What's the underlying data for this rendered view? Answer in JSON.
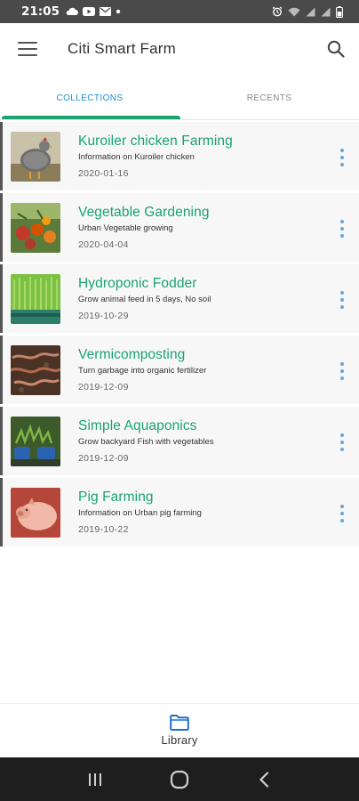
{
  "status_bar": {
    "time": "21:05",
    "left_icons": [
      "cloud-icon",
      "youtube-icon",
      "mail-icon",
      "dot-icon"
    ],
    "right_icons": [
      "alarm-icon",
      "wifi-icon",
      "signal-icon",
      "signal-icon",
      "battery-icon"
    ]
  },
  "app_bar": {
    "title": "Citi Smart Farm",
    "menu_icon": "hamburger-menu-icon",
    "search_icon": "search-icon"
  },
  "tabs": [
    {
      "label": "COLLECTIONS",
      "active": true
    },
    {
      "label": "RECENTS",
      "active": false
    }
  ],
  "colors": {
    "accent_green": "#1aa371",
    "tab_active_blue": "#1d8ecf",
    "more_dots": "#6aa6d6",
    "status_bar": "#4a4a4a",
    "system_nav": "#1e1e1e"
  },
  "collections": [
    {
      "title": "Kuroiler chicken Farming",
      "description": "Information on Kuroiler chicken",
      "date": "2020-01-16",
      "thumbnail": "chicken-photo"
    },
    {
      "title": "Vegetable Gardening",
      "description": "Urban Vegetable growing",
      "date": "2020-04-04",
      "thumbnail": "tomatoes-photo"
    },
    {
      "title": "Hydroponic Fodder",
      "description": "Grow animal feed in 5 days, No soil",
      "date": "2019-10-29",
      "thumbnail": "grass-tray-photo"
    },
    {
      "title": "Vermicomposting",
      "description": "Turn garbage into organic fertilizer",
      "date": "2019-12-09",
      "thumbnail": "worms-compost-photo"
    },
    {
      "title": "Simple Aquaponics",
      "description": "Grow backyard Fish with vegetables",
      "date": "2019-12-09",
      "thumbnail": "aquaponics-photo"
    },
    {
      "title": "Pig Farming",
      "description": "Information on Urban pig farming",
      "date": "2019-10-22",
      "thumbnail": "pig-photo"
    }
  ],
  "bottom_nav": {
    "label": "Library",
    "icon": "folder-icon"
  },
  "system_nav": [
    "recent-apps-icon",
    "home-icon",
    "back-icon"
  ]
}
